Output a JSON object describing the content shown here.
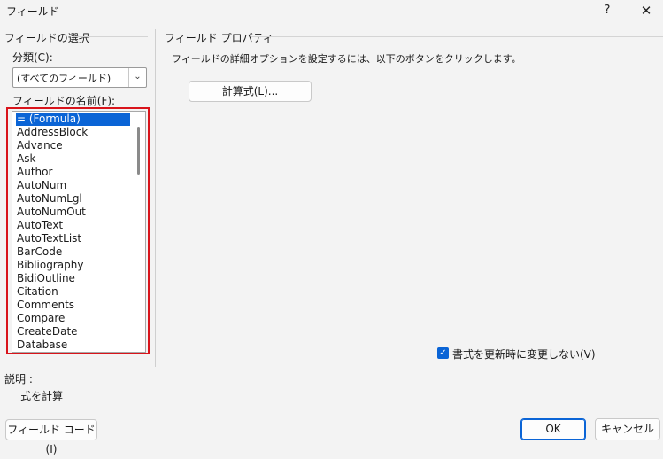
{
  "window": {
    "title": "フィールド",
    "help_label": "?",
    "close_label": "✕"
  },
  "left_panel": {
    "title": "フィールドの選択",
    "category_label": "分類(C):",
    "category_value": "(すべてのフィールド)",
    "names_label": "フィールドの名前(F):",
    "field_names": [
      "= (Formula)",
      "AddressBlock",
      "Advance",
      "Ask",
      "Author",
      "AutoNum",
      "AutoNumLgl",
      "AutoNumOut",
      "AutoText",
      "AutoTextList",
      "BarCode",
      "Bibliography",
      "BidiOutline",
      "Citation",
      "Comments",
      "Compare",
      "CreateDate",
      "Database"
    ],
    "selected_index": 0
  },
  "right_panel": {
    "title": "フィールド プロパティ",
    "description": "フィールドの詳細オプションを設定するには、以下のボタンをクリックします。",
    "formula_button": "計算式(L)...",
    "preserve_format_label": "書式を更新時に変更しない(V)",
    "preserve_format_checked": true
  },
  "description": {
    "title": "説明 :",
    "text": "式を計算"
  },
  "footer": {
    "field_codes_button": "フィールド コード(I)",
    "ok_button": "OK",
    "cancel_button": "キャンセル"
  },
  "colors": {
    "accent": "#0a64d6",
    "highlight_frame": "#d9141b",
    "background": "#f3f3f3"
  },
  "icons": {
    "dropdown": "chevron-down-icon",
    "checkbox": "checkmark-icon"
  }
}
